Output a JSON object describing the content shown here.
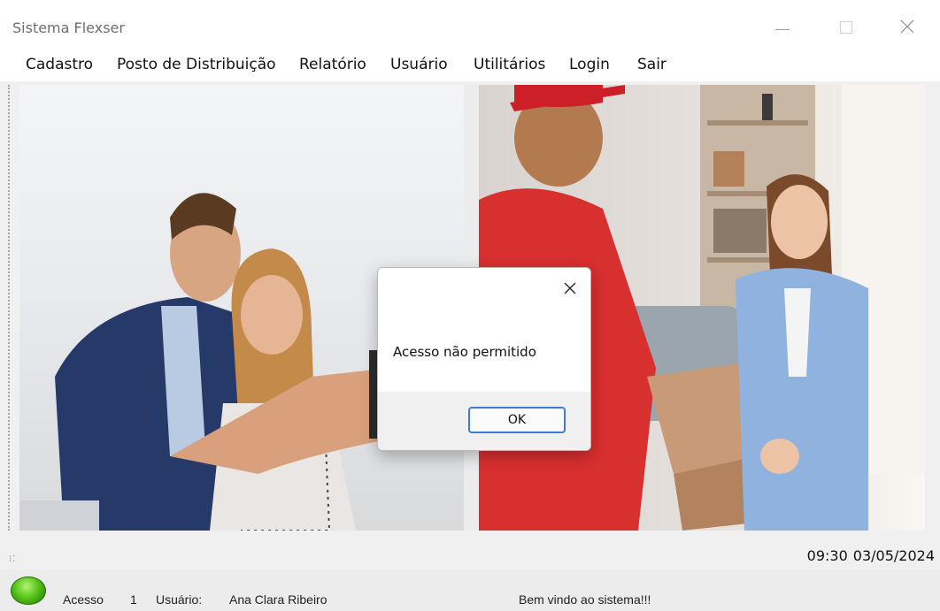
{
  "window": {
    "title": "Sistema Flexser"
  },
  "menu": {
    "items": [
      "Cadastro",
      "Posto de Distribuição",
      "Relatório",
      "Usuário",
      "Utilitários",
      "Login",
      "Sair"
    ]
  },
  "dialog": {
    "message": "Acesso não permitido",
    "ok_label": "OK"
  },
  "status": {
    "time": "09:30",
    "date": "03/05/2024",
    "acesso_label": "Acesso",
    "acesso_value": "1",
    "usuario_label": "Usuário:",
    "usuario_value": "Ana Clara Ribeiro",
    "welcome": "Bem vindo ao sistema!!!"
  },
  "icons": {
    "close": "close-icon",
    "minimize": "minimize-icon",
    "maximize": "maximize-icon",
    "status_led": "status-led-icon"
  },
  "colors": {
    "dialog_button_border": "#3b7bd8",
    "led_green": "#5bc91c"
  }
}
